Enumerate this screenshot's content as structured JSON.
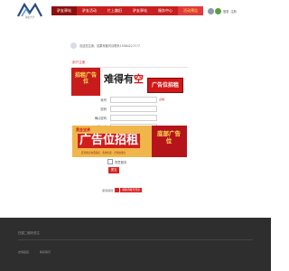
{
  "header": {
    "logo_text": "湖北大学",
    "nav": [
      {
        "label": "驴友驿站",
        "style": "active"
      },
      {
        "label": "驴友活动",
        "style": "normal"
      },
      {
        "label": "忙上趣旧",
        "style": "normal"
      },
      {
        "label": "驴友驿站",
        "style": "normal"
      },
      {
        "label": "服务中心",
        "style": "normal"
      },
      {
        "label": "活动预告",
        "style": "hot"
      }
    ],
    "user_links": [
      "登录",
      "注册"
    ]
  },
  "info": {
    "text": "欢迎您注册，如果有疑问请联系15984227177"
  },
  "section": {
    "title": "用户注册"
  },
  "banner_top": {
    "left_vertical": "招租广告位",
    "headline_a": "难得有",
    "headline_b": "空",
    "sign_text": "广告位招租"
  },
  "form": {
    "fields": [
      {
        "label": "帐号",
        "hint": "必填"
      },
      {
        "label": "密码",
        "hint": ""
      },
      {
        "label": "确认密码",
        "hint": ""
      },
      {
        "label": "Email",
        "hint": ""
      },
      {
        "label": "安全提问",
        "hint": "",
        "select_value": "安全提问(未设置请忽略)"
      }
    ]
  },
  "banner_bottom": {
    "slogan": "黄金宝贵",
    "main_text": "广告位招租",
    "small_text": "赶紧拨打电话联系 · 黄金位置 · 宣传效果好",
    "right_vertical": "底部广告位"
  },
  "agree": {
    "label": "同意服务"
  },
  "submit": {
    "label": "提交"
  },
  "partner": {
    "label": "使用其他",
    "button_label": "用腾讯帐号登录"
  },
  "footer": {
    "top_text": "扫描二维码关注",
    "links": [
      "友情链接",
      "联系我们"
    ]
  },
  "colors": {
    "brand_red": "#c81f1f",
    "footer_bg": "#2e2e2e"
  }
}
